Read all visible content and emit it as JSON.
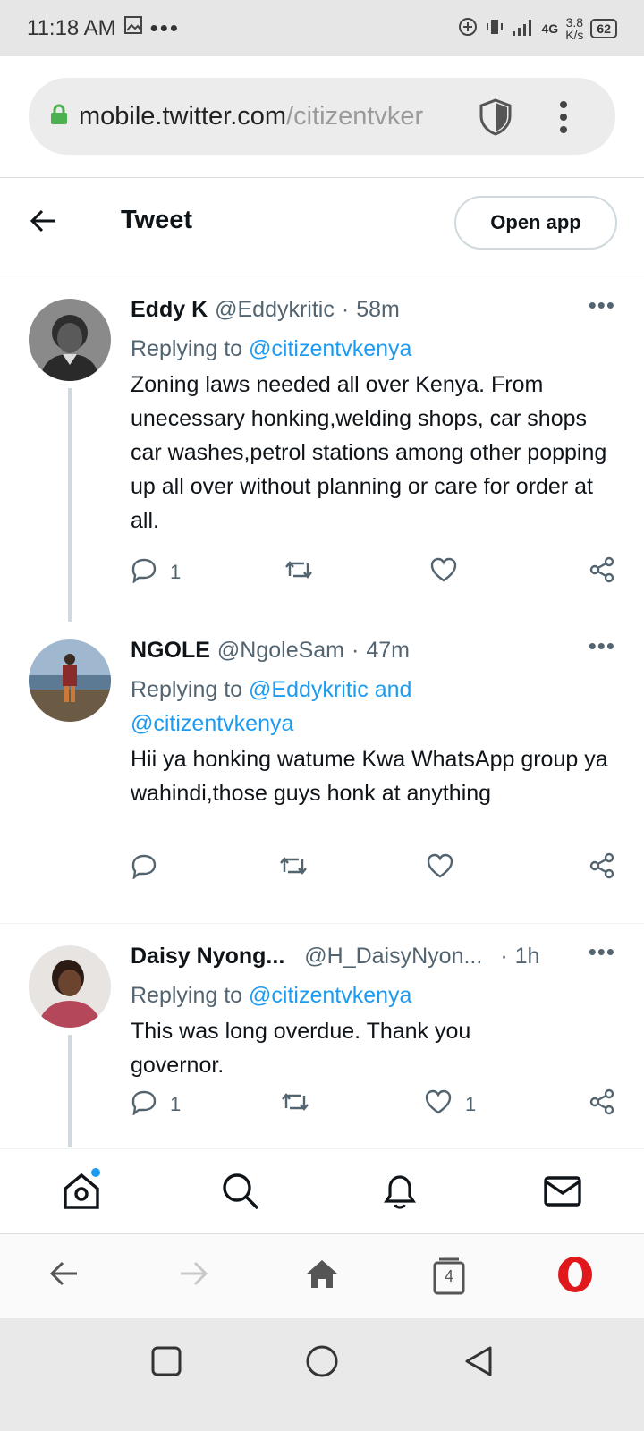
{
  "status": {
    "time": "11:18 AM",
    "network": "4G",
    "speed": "3.8",
    "speed_unit": "K/s",
    "battery": "62"
  },
  "browser": {
    "url_host": "mobile.twitter.com",
    "url_path": "/citizentvker",
    "tabs_count": "4"
  },
  "header": {
    "title": "Tweet",
    "open_app": "Open app"
  },
  "tweets": [
    {
      "name": "Eddy K",
      "handle": "@Eddykritic",
      "time": "58m",
      "replying_prefix": "Replying to ",
      "replying_to": "@citizentvkenya",
      "text": "Zoning laws needed all over Kenya. From unecessary honking,welding shops, car shops car washes,petrol stations among other popping up all over without planning or care for order at all.",
      "replies": "1",
      "retweets": "",
      "likes": ""
    },
    {
      "name": "NGOLE",
      "handle": "@NgoleSam",
      "time": "47m",
      "replying_prefix": "Replying to ",
      "replying_to": "@Eddykritic and @citizentvkenya",
      "text": "Hii ya honking watume Kwa WhatsApp group ya wahindi,those guys honk at anything",
      "replies": "",
      "retweets": "",
      "likes": ""
    },
    {
      "name": "Daisy Nyong...",
      "handle": "@H_DaisyNyon...",
      "time": "1h",
      "replying_prefix": "Replying to ",
      "replying_to": "@citizentvkenya",
      "text": "This was long overdue. Thank you governor.",
      "replies": "1",
      "retweets": "",
      "likes": "1"
    }
  ],
  "colors": {
    "twitter_blue": "#1d9bf0",
    "secondary_text": "#536471",
    "opera_red": "#e0171b",
    "lock_green": "#4caf50"
  }
}
